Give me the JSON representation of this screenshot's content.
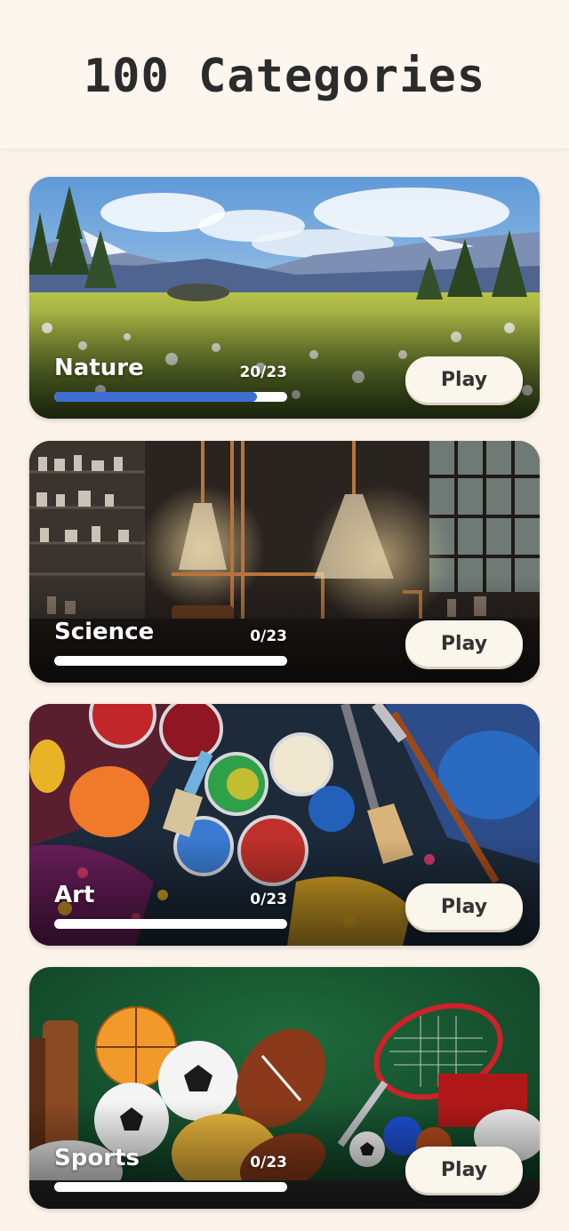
{
  "header": {
    "title": "100  Categories"
  },
  "colors": {
    "background": "#fcf4ea",
    "progress_fill": "#3f6fd1",
    "progress_track": "#ffffff",
    "play_button": "#fbf6ec"
  },
  "categories": [
    {
      "name": "Nature",
      "progress_text": "20/23",
      "completed": 20,
      "total": 23,
      "play_label": "Play",
      "image": "mountain-meadow-image"
    },
    {
      "name": "Science",
      "progress_text": "0/23",
      "completed": 0,
      "total": 23,
      "play_label": "Play",
      "image": "laboratory-flasks-image"
    },
    {
      "name": "Art",
      "progress_text": "0/23",
      "completed": 0,
      "total": 23,
      "play_label": "Play",
      "image": "paint-pots-brushes-image"
    },
    {
      "name": "Sports",
      "progress_text": "0/23",
      "completed": 0,
      "total": 23,
      "play_label": "Play",
      "image": "sports-balls-image"
    }
  ]
}
